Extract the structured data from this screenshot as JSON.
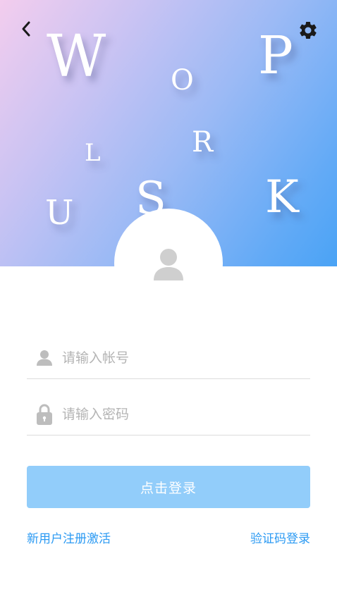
{
  "hero": {
    "letters": [
      "W",
      "O",
      "P",
      "L",
      "R",
      "U",
      "S",
      "K"
    ]
  },
  "icons": {
    "back": "chevron-left-icon",
    "settings": "gear-icon",
    "avatar": "user-avatar-icon",
    "account": "user-icon",
    "password": "lock-icon"
  },
  "form": {
    "account_placeholder": "请输入帐号",
    "password_placeholder": "请输入密码",
    "login_label": "点击登录"
  },
  "links": {
    "register": "新用户注册激活",
    "sms_login": "验证码登录"
  },
  "colors": {
    "accent": "#2b9af3",
    "button": "#92cdfa"
  }
}
